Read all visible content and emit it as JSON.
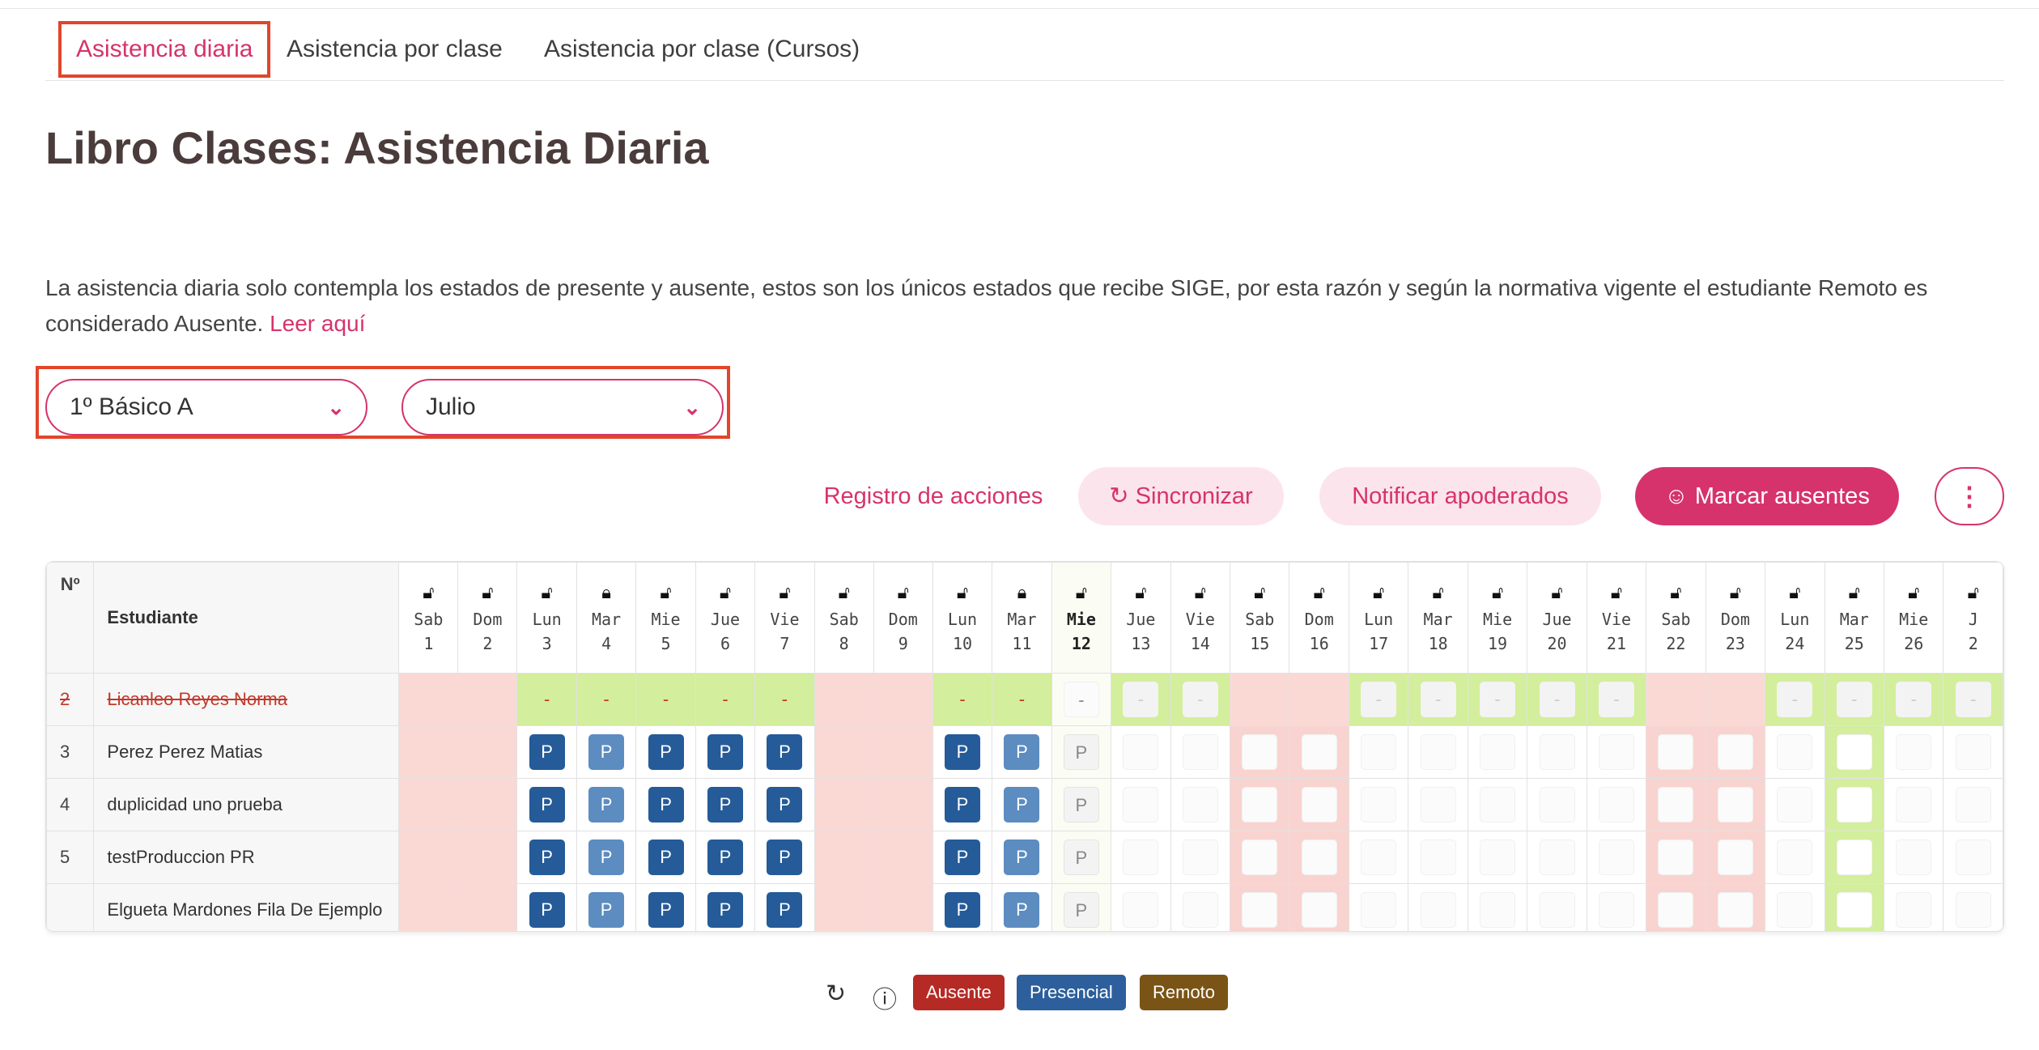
{
  "tabs": [
    {
      "label": "Asistencia diaria",
      "active": true
    },
    {
      "label": "Asistencia por clase"
    },
    {
      "label": "Asistencia por clase (Cursos)"
    }
  ],
  "title": "Libro Clases: Asistencia Diaria",
  "info": {
    "text": "La asistencia diaria solo contempla los estados de presente y ausente, estos son los únicos estados que recibe SIGE, por esta razón y según la normativa vigente el estudiante Remoto es considerado Ausente.",
    "link": "Leer aquí"
  },
  "filters": {
    "course": "1º Básico A",
    "month": "Julio"
  },
  "actions": {
    "log": "Registro de acciones",
    "sync": "Sincronizar",
    "notify": "Notificar apoderados",
    "mark_absent": "Marcar ausentes",
    "more": "⋮"
  },
  "table": {
    "col_no": "Nº",
    "col_student": "Estudiante",
    "days": [
      {
        "name": "Sab",
        "num": "1",
        "lock": "open",
        "type": "weekend"
      },
      {
        "name": "Dom",
        "num": "2",
        "lock": "open",
        "type": "weekend"
      },
      {
        "name": "Lun",
        "num": "3",
        "lock": "open",
        "type": "past"
      },
      {
        "name": "Mar",
        "num": "4",
        "lock": "closed",
        "type": "past"
      },
      {
        "name": "Mie",
        "num": "5",
        "lock": "open",
        "type": "past"
      },
      {
        "name": "Jue",
        "num": "6",
        "lock": "open",
        "type": "past"
      },
      {
        "name": "Vie",
        "num": "7",
        "lock": "open",
        "type": "past"
      },
      {
        "name": "Sab",
        "num": "8",
        "lock": "open",
        "type": "weekend"
      },
      {
        "name": "Dom",
        "num": "9",
        "lock": "open",
        "type": "weekend"
      },
      {
        "name": "Lun",
        "num": "10",
        "lock": "open",
        "type": "past"
      },
      {
        "name": "Mar",
        "num": "11",
        "lock": "closed",
        "type": "past"
      },
      {
        "name": "Mie",
        "num": "12",
        "lock": "open",
        "type": "today"
      },
      {
        "name": "Jue",
        "num": "13",
        "lock": "open",
        "type": "future"
      },
      {
        "name": "Vie",
        "num": "14",
        "lock": "open",
        "type": "future"
      },
      {
        "name": "Sab",
        "num": "15",
        "lock": "open",
        "type": "weekend"
      },
      {
        "name": "Dom",
        "num": "16",
        "lock": "open",
        "type": "weekend"
      },
      {
        "name": "Lun",
        "num": "17",
        "lock": "open",
        "type": "future"
      },
      {
        "name": "Mar",
        "num": "18",
        "lock": "open",
        "type": "future"
      },
      {
        "name": "Mie",
        "num": "19",
        "lock": "open",
        "type": "future"
      },
      {
        "name": "Jue",
        "num": "20",
        "lock": "open",
        "type": "future"
      },
      {
        "name": "Vie",
        "num": "21",
        "lock": "open",
        "type": "future"
      },
      {
        "name": "Sab",
        "num": "22",
        "lock": "open",
        "type": "weekend"
      },
      {
        "name": "Dom",
        "num": "23",
        "lock": "open",
        "type": "weekend"
      },
      {
        "name": "Lun",
        "num": "24",
        "lock": "open",
        "type": "future"
      },
      {
        "name": "Mar",
        "num": "25",
        "lock": "open",
        "type": "future-green"
      },
      {
        "name": "Mie",
        "num": "26",
        "lock": "open",
        "type": "future"
      },
      {
        "name": "J",
        "num": "2",
        "lock": "open",
        "type": "future"
      }
    ],
    "students": [
      {
        "no": "2",
        "name": "Licanleo Reyes Norma",
        "withdrawn": true
      },
      {
        "no": "3",
        "name": "Perez Perez Matias",
        "withdrawn": false
      },
      {
        "no": "4",
        "name": "duplicidad uno prueba",
        "withdrawn": false
      },
      {
        "no": "5",
        "name": "testProduccion PR",
        "withdrawn": false
      },
      {
        "no": "",
        "name": "Elgueta Mardones Fila De Ejemplo",
        "withdrawn": false
      }
    ],
    "mark_present": "P",
    "mark_none": "-"
  },
  "legend": {
    "absent": "Ausente",
    "present": "Presencial",
    "remote": "Remoto"
  },
  "colors": {
    "accent": "#d6336c",
    "absent": "#b52a25",
    "present": "#2d5f9c",
    "remote": "#7a5416"
  }
}
